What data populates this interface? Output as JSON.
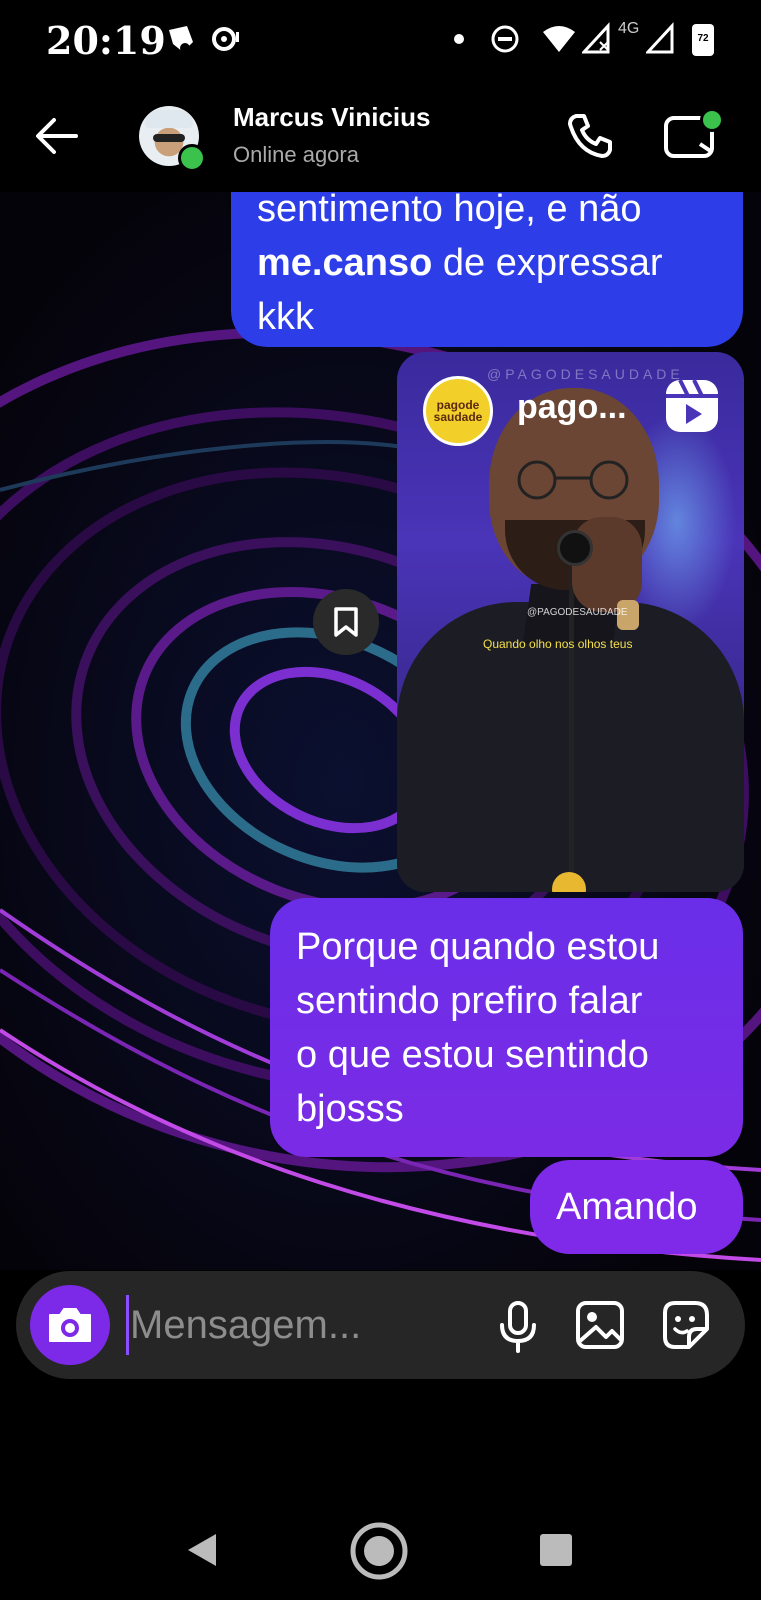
{
  "status_bar": {
    "time": "20:19",
    "network": "4G",
    "battery": "72",
    "icons": [
      "spotify-icon",
      "cast-icon",
      "dot-icon",
      "dnd-icon",
      "wifi-icon",
      "signal-icon",
      "signal-icon",
      "battery-icon"
    ]
  },
  "header": {
    "contact_name": "Marcus Vinicius",
    "contact_status": "Online agora",
    "online_color": "#3ac24c"
  },
  "messages": [
    {
      "type": "text",
      "lines": [
        "sentimento hoje, e não",
        "me.canso de expressar",
        "kkk"
      ],
      "bold_word": "me.canso",
      "color": "#2d3ee8",
      "partially_visible": true
    },
    {
      "type": "reel",
      "account": "pago...",
      "logo_text": "pagode saudade",
      "watermark": "@PAGODESAUDADE",
      "caption": "Quando olho nos olhos teus"
    },
    {
      "type": "text",
      "lines": [
        "Porque quando estou",
        "sentindo prefiro falar",
        "o que estou sentindo",
        "bjosss"
      ],
      "color": "#6a2ee8"
    },
    {
      "type": "text",
      "lines": [
        "Amando"
      ],
      "color": "#7e2ae8"
    }
  ],
  "composer": {
    "placeholder": "Mensagem...",
    "icons": [
      "camera-icon",
      "microphone-icon",
      "gallery-icon",
      "sticker-icon"
    ],
    "accent": "#7d2ae8"
  },
  "nav_bar": {
    "icons": [
      "back-triangle-icon",
      "home-circle-icon",
      "recents-square-icon"
    ]
  }
}
